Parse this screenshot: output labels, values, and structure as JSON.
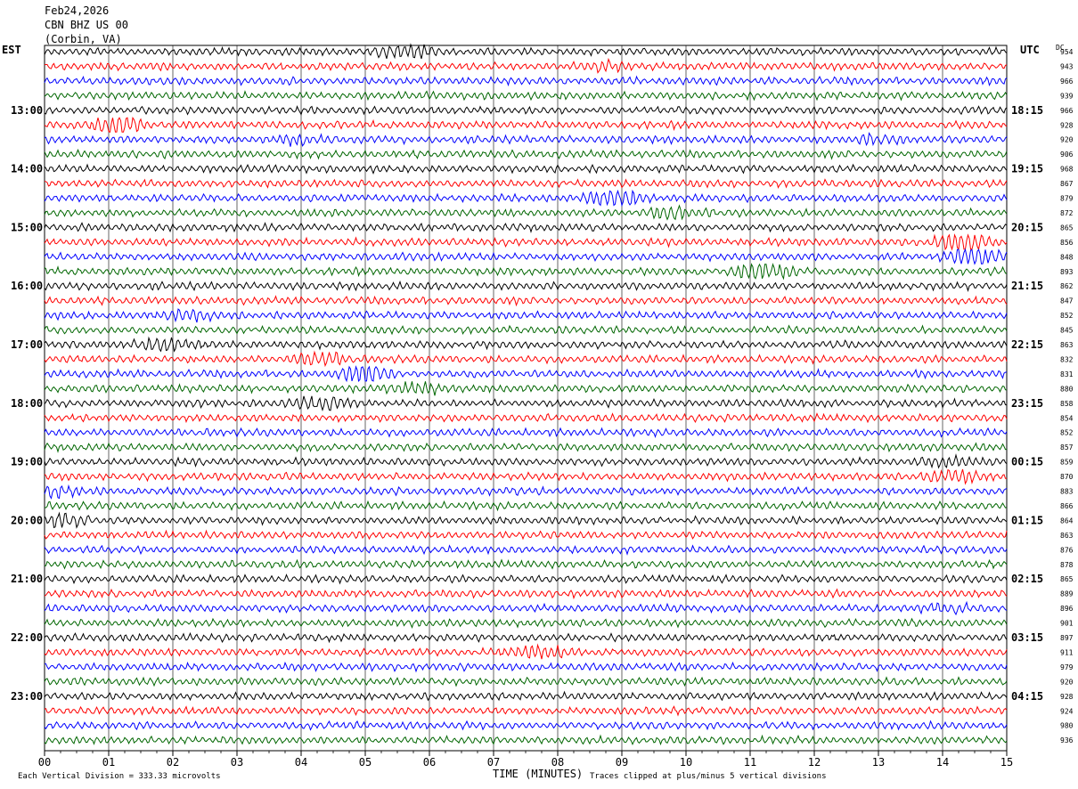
{
  "header": {
    "date": "Feb24,2026",
    "station": "CBN BHZ US 00",
    "location": "(Corbin, VA)",
    "left_tz": "EST",
    "right_tz": "UTC",
    "dc_label": "DC"
  },
  "footer": {
    "scale_text": "Each Vertical Division =  333.33 microvolts",
    "xaxis_title": "TIME (MINUTES)",
    "clip_text": "Traces clipped at plus/minus 5 vertical divisions"
  },
  "chart_data": {
    "type": "line",
    "title": "CBN BHZ US 00 (Corbin, VA)",
    "xlabel": "TIME (MINUTES)",
    "ylabel": "",
    "xlim": [
      0,
      15
    ],
    "x_ticks": [
      "00",
      "01",
      "02",
      "03",
      "04",
      "05",
      "06",
      "07",
      "08",
      "09",
      "10",
      "11",
      "12",
      "13",
      "14",
      "15"
    ],
    "left_hour_labels": [
      "13:00",
      "14:00",
      "15:00",
      "16:00",
      "17:00",
      "18:00",
      "19:00",
      "20:00",
      "21:00",
      "22:00",
      "23:00"
    ],
    "right_hour_labels": [
      "18:15",
      "19:15",
      "20:15",
      "21:15",
      "22:15",
      "23:15",
      "00:15",
      "01:15",
      "02:15",
      "03:15",
      "04:15"
    ],
    "trace_colors": [
      "#000000",
      "#ff0000",
      "#0000ff",
      "#006600"
    ],
    "dc_values": [
      "954",
      "943",
      "966",
      "939",
      "966",
      "928",
      "920",
      "906",
      "968",
      "867",
      "879",
      "872",
      "865",
      "856",
      "848",
      "893",
      "862",
      "847",
      "852",
      "845",
      "863",
      "832",
      "831",
      "880",
      "858",
      "854",
      "852",
      "857",
      "859",
      "870",
      "883",
      "866",
      "864",
      "863",
      "876",
      "878",
      "865",
      "889",
      "896",
      "901",
      "897",
      "911",
      "979",
      "920",
      "928",
      "924",
      "980",
      "936"
    ],
    "bursts": [
      {
        "trace": 0,
        "minute": 5.6,
        "amplitude": 2.2
      },
      {
        "trace": 1,
        "minute": 8.8,
        "amplitude": 1.6
      },
      {
        "trace": 5,
        "minute": 1.1,
        "amplitude": 2.4
      },
      {
        "trace": 6,
        "minute": 4.0,
        "amplitude": 1.8
      },
      {
        "trace": 6,
        "minute": 13.0,
        "amplitude": 1.5
      },
      {
        "trace": 10,
        "minute": 8.9,
        "amplitude": 2.4
      },
      {
        "trace": 11,
        "minute": 9.8,
        "amplitude": 1.8
      },
      {
        "trace": 13,
        "minute": 14.3,
        "amplitude": 2.6
      },
      {
        "trace": 14,
        "minute": 14.5,
        "amplitude": 3.0
      },
      {
        "trace": 15,
        "minute": 11.2,
        "amplitude": 2.6
      },
      {
        "trace": 18,
        "minute": 2.2,
        "amplitude": 1.8
      },
      {
        "trace": 20,
        "minute": 1.8,
        "amplitude": 2.0
      },
      {
        "trace": 21,
        "minute": 4.3,
        "amplitude": 2.0
      },
      {
        "trace": 22,
        "minute": 5.0,
        "amplitude": 2.4
      },
      {
        "trace": 23,
        "minute": 5.8,
        "amplitude": 2.0
      },
      {
        "trace": 24,
        "minute": 4.2,
        "amplitude": 2.2
      },
      {
        "trace": 28,
        "minute": 14.0,
        "amplitude": 1.6
      },
      {
        "trace": 29,
        "minute": 14.2,
        "amplitude": 2.0
      },
      {
        "trace": 30,
        "minute": 0.1,
        "amplitude": 1.8
      },
      {
        "trace": 32,
        "minute": 0.2,
        "amplitude": 2.0
      },
      {
        "trace": 38,
        "minute": 14.1,
        "amplitude": 1.5
      },
      {
        "trace": 41,
        "minute": 7.7,
        "amplitude": 2.0
      }
    ]
  }
}
